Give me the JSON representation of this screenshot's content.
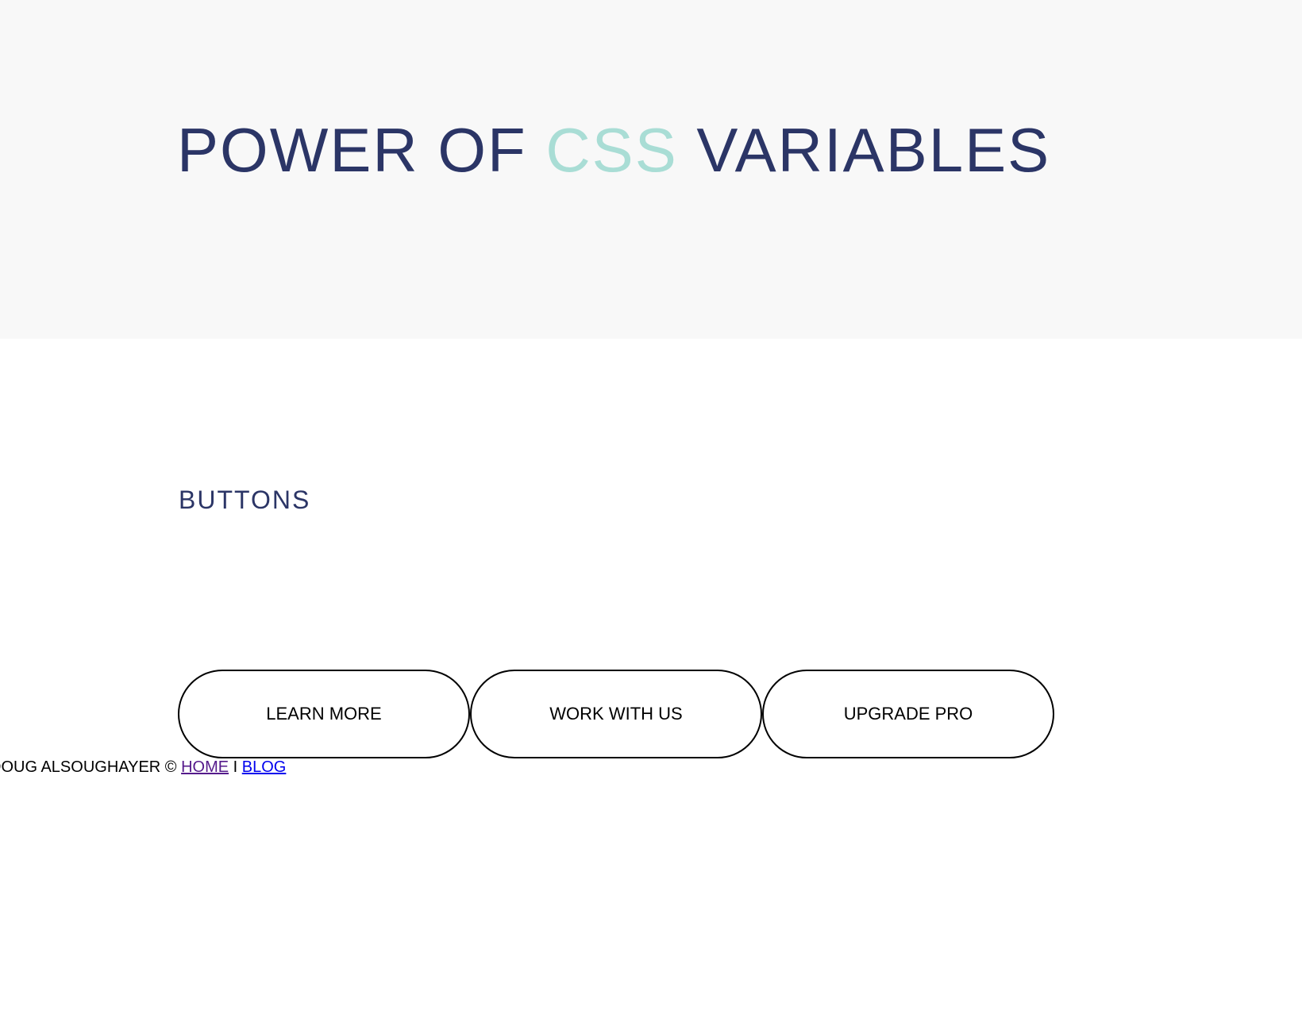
{
  "hero": {
    "title_pre": "POWER OF ",
    "title_accent": "CSS",
    "title_post": " VARIABLES"
  },
  "section": {
    "title": "BUTTONS"
  },
  "buttons": [
    {
      "label": "LEARN MORE"
    },
    {
      "label": "WORK WITH US"
    },
    {
      "label": "UPGRADE PRO"
    }
  ],
  "footer": {
    "credit": "DOUG ALSOUGHAYER © ",
    "home_link": "HOME",
    "separator": " I ",
    "blog_link": "BLOG"
  },
  "colors": {
    "primary_text": "#2b3566",
    "accent": "#a9ddd5",
    "hero_background": "#f8f8f8",
    "visited_link": "#551a8b",
    "link": "#0000ee"
  }
}
